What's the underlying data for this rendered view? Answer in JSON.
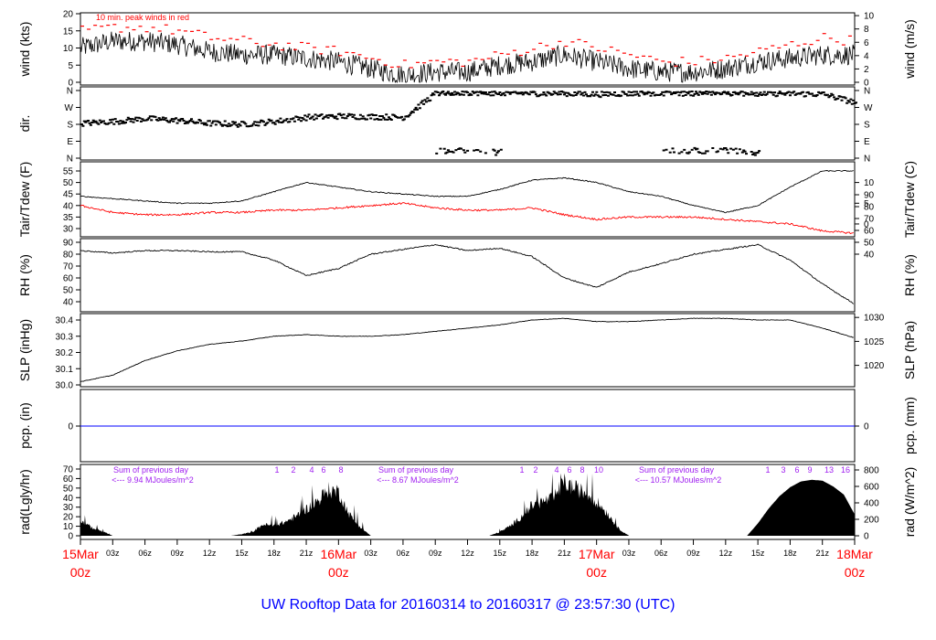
{
  "title": "UW Rooftop Data for 20160314  to  20160317 @ 23:57:30  (UTC)",
  "colors": {
    "main": "#000000",
    "peak": "#ff0000",
    "dew": "#ff0000",
    "pcp": "#0000ff",
    "annot": "#a020f0",
    "date": "#ff0000",
    "title": "#0000ff"
  },
  "chart_data": [
    {
      "type": "line",
      "name": "wind",
      "ylabel": "wind (kts)",
      "ylabel_right": "wind (m/s)",
      "ylim": [
        0,
        20
      ],
      "yticks": [
        "0",
        "5",
        "10",
        "15",
        "20"
      ],
      "yticks_right": [
        "0",
        "2",
        "4",
        "6",
        "8",
        "10"
      ],
      "annotation": "10 min. peak winds in red",
      "x_hours": [
        0,
        3,
        6,
        9,
        12,
        15,
        18,
        21,
        24,
        27,
        30,
        33,
        36,
        39,
        42,
        45,
        48,
        51,
        54,
        57,
        60,
        63,
        66,
        69,
        72
      ],
      "series": [
        {
          "name": "wind speed",
          "values": [
            10,
            12,
            12,
            11,
            9,
            8,
            8,
            7,
            6,
            4,
            2,
            3,
            3,
            5,
            6,
            8,
            6,
            4,
            3,
            3,
            4,
            6,
            7,
            8,
            8
          ]
        },
        {
          "name": "10 min peak",
          "values": [
            15,
            16,
            16,
            15,
            13,
            12,
            11,
            10,
            9,
            7,
            5,
            6,
            6,
            8,
            10,
            12,
            10,
            8,
            6,
            6,
            7,
            9,
            11,
            13,
            12
          ]
        }
      ]
    },
    {
      "type": "scatter",
      "name": "dir",
      "ylabel": "dir.",
      "yticks": [
        "N",
        "E",
        "S",
        "W",
        "N"
      ],
      "x_hours": [
        0,
        3,
        6,
        9,
        12,
        15,
        18,
        21,
        24,
        27,
        30,
        33,
        36,
        39,
        42,
        45,
        48,
        51,
        54,
        57,
        60,
        63,
        66,
        69,
        72
      ],
      "series": [
        {
          "name": "direction_deg",
          "values": [
            190,
            200,
            215,
            205,
            190,
            185,
            200,
            222,
            228,
            225,
            222,
            352,
            355,
            352,
            350,
            348,
            345,
            350,
            352,
            350,
            352,
            350,
            348,
            345,
            300
          ]
        },
        {
          "name": "secondary_deg",
          "values": [
            null,
            null,
            null,
            null,
            null,
            null,
            null,
            null,
            null,
            null,
            null,
            40,
            45,
            35,
            null,
            null,
            null,
            null,
            40,
            45,
            45,
            35,
            null,
            null,
            null
          ]
        }
      ]
    },
    {
      "type": "line",
      "name": "temperature",
      "ylabel": "Tair/Tdew (F)",
      "ylabel_right": "Tair/Tdew (C)",
      "yticks": [
        "30",
        "35",
        "40",
        "45",
        "50",
        "55"
      ],
      "yticks_right": [
        "0",
        "5",
        "10"
      ],
      "x_hours": [
        0,
        3,
        6,
        9,
        12,
        15,
        18,
        21,
        24,
        27,
        30,
        33,
        36,
        39,
        42,
        45,
        48,
        51,
        54,
        57,
        60,
        63,
        66,
        69,
        72
      ],
      "series": [
        {
          "name": "Tair",
          "values": [
            44,
            43,
            42,
            41,
            41,
            42,
            46,
            50,
            48,
            46,
            45,
            44,
            44,
            47,
            51,
            52,
            50,
            46,
            44,
            40,
            37,
            40,
            48,
            55,
            55
          ]
        },
        {
          "name": "Tdew",
          "values": [
            40,
            37,
            36,
            36,
            37,
            37,
            38,
            38,
            39,
            40,
            41,
            39,
            38,
            38,
            39,
            36,
            34,
            35,
            35,
            35,
            34,
            33,
            32,
            29,
            28
          ]
        }
      ]
    },
    {
      "type": "line",
      "name": "rh",
      "ylabel": "RH (%)",
      "ylabel_right": "RH (%)",
      "yticks": [
        "40",
        "50",
        "60",
        "70",
        "80",
        "90"
      ],
      "x_hours": [
        0,
        3,
        6,
        9,
        12,
        15,
        18,
        21,
        24,
        27,
        30,
        33,
        36,
        39,
        42,
        45,
        48,
        51,
        54,
        57,
        60,
        63,
        66,
        69,
        72
      ],
      "values": [
        83,
        81,
        83,
        83,
        82,
        82,
        75,
        62,
        68,
        80,
        84,
        88,
        83,
        85,
        78,
        60,
        52,
        65,
        72,
        80,
        84,
        88,
        75,
        55,
        38
      ]
    },
    {
      "type": "line",
      "name": "slp",
      "ylabel": "SLP (inHg)",
      "ylabel_right": "SLP (hPa)",
      "yticks": [
        "30.0",
        "30.1",
        "30.2",
        "30.3",
        "30.4"
      ],
      "yticks_right": [
        "1020",
        "1025",
        "1030"
      ],
      "x_hours": [
        0,
        3,
        6,
        9,
        12,
        15,
        18,
        21,
        24,
        27,
        30,
        33,
        36,
        39,
        42,
        45,
        48,
        51,
        54,
        57,
        60,
        63,
        66,
        69,
        72
      ],
      "values": [
        30.02,
        30.06,
        30.15,
        30.21,
        30.25,
        30.27,
        30.3,
        30.31,
        30.3,
        30.3,
        30.31,
        30.33,
        30.35,
        30.37,
        30.4,
        30.41,
        30.39,
        30.39,
        30.4,
        30.41,
        30.41,
        30.4,
        30.4,
        30.35,
        30.29
      ]
    },
    {
      "type": "line",
      "name": "pcp",
      "ylabel": "pcp. (in)",
      "ylabel_right": "pcp. (mm)",
      "yticks": [
        "0"
      ],
      "yticks_right": [
        "0"
      ],
      "value": 0
    },
    {
      "type": "area",
      "name": "rad",
      "ylabel": "rad(Lgly/hr)",
      "ylabel_right": "rad (W/m^2)",
      "yticks": [
        "0",
        "10",
        "20",
        "30",
        "40",
        "50",
        "60",
        "70"
      ],
      "yticks_right": [
        "0",
        "200",
        "400",
        "600",
        "800"
      ],
      "values_wm2_hourly": [
        200,
        110,
        60,
        0,
        0,
        0,
        0,
        0,
        0,
        0,
        0,
        0,
        0,
        0,
        0,
        20,
        50,
        150,
        130,
        180,
        250,
        350,
        450,
        600,
        580,
        280,
        120,
        0,
        0,
        0,
        0,
        0,
        0,
        0,
        0,
        0,
        0,
        0,
        0,
        50,
        130,
        250,
        400,
        450,
        500,
        700,
        620,
        560,
        450,
        300,
        100,
        0,
        0,
        0,
        0,
        0,
        0,
        0,
        0,
        0,
        0,
        0,
        0,
        150,
        330,
        480,
        590,
        660,
        680,
        670,
        600,
        500,
        260
      ],
      "daily_sums": [
        {
          "line1": "Sum of previous day",
          "line2": "<--- 9.94 MJoules/m^2",
          "hours": [
            "1",
            "2",
            "4",
            "6",
            "8"
          ]
        },
        {
          "line1": "Sum of previous day",
          "line2": "<--- 8.67 MJoules/m^2",
          "hours": [
            "1",
            "2",
            "4",
            "6",
            "8",
            "10"
          ]
        },
        {
          "line1": "Sum of previous day",
          "line2": "<--- 10.57 MJoules/m^2",
          "hours": [
            "1",
            "3",
            "6",
            "9",
            "13",
            "16"
          ]
        }
      ]
    }
  ],
  "time_axis": {
    "hour_labels": [
      "03z",
      "06z",
      "09z",
      "12z",
      "15z",
      "18z",
      "21z"
    ],
    "dates": [
      {
        "day": "15Mar",
        "hour": "00z"
      },
      {
        "day": "16Mar",
        "hour": "00z"
      },
      {
        "day": "17Mar",
        "hour": "00z"
      },
      {
        "day": "18Mar",
        "hour": "00z"
      }
    ]
  }
}
